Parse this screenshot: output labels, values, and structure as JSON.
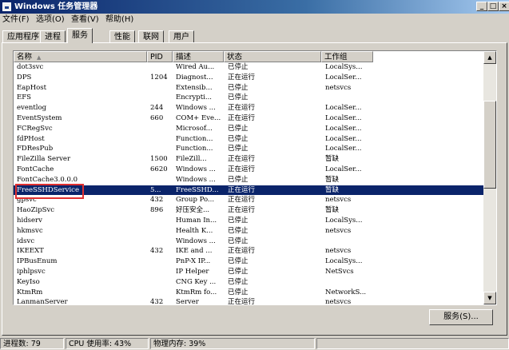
{
  "window": {
    "title": "Windows 任务管理器",
    "minimize": "_",
    "maximize": "□",
    "close": "×"
  },
  "menu": [
    "文件(F)",
    "选项(O)",
    "查看(V)",
    "帮助(H)"
  ],
  "tabs": [
    "应用程序",
    "进程",
    "服务",
    "性能",
    "联网",
    "用户"
  ],
  "active_tab": "服务",
  "columns": {
    "name": "名称",
    "pid": "PID",
    "desc": "描述",
    "status": "状态",
    "group": "工作组"
  },
  "rows": [
    {
      "name": "dot3svc",
      "pid": "",
      "desc": "Wired Au...",
      "status": "已停止",
      "group": "LocalSys..."
    },
    {
      "name": "DPS",
      "pid": "1204",
      "desc": "Diagnost...",
      "status": "正在运行",
      "group": "LocalSer..."
    },
    {
      "name": "EapHost",
      "pid": "",
      "desc": "Extensib...",
      "status": "已停止",
      "group": "netsvcs"
    },
    {
      "name": "EFS",
      "pid": "",
      "desc": "Encrypti...",
      "status": "已停止",
      "group": ""
    },
    {
      "name": "eventlog",
      "pid": "244",
      "desc": "Windows ...",
      "status": "正在运行",
      "group": "LocalSer..."
    },
    {
      "name": "EventSystem",
      "pid": "660",
      "desc": "COM+ Eve...",
      "status": "正在运行",
      "group": "LocalSer..."
    },
    {
      "name": "FCRegSvc",
      "pid": "",
      "desc": "Microsof...",
      "status": "已停止",
      "group": "LocalSer..."
    },
    {
      "name": "fdPHost",
      "pid": "",
      "desc": "Function...",
      "status": "已停止",
      "group": "LocalSer..."
    },
    {
      "name": "FDResPub",
      "pid": "",
      "desc": "Function...",
      "status": "已停止",
      "group": "LocalSer..."
    },
    {
      "name": "FileZilla Server",
      "pid": "1500",
      "desc": "FileZill...",
      "status": "正在运行",
      "group": "暂缺"
    },
    {
      "name": "FontCache",
      "pid": "6620",
      "desc": "Windows ...",
      "status": "正在运行",
      "group": "LocalSer..."
    },
    {
      "name": "FontCache3.0.0.0",
      "pid": "",
      "desc": "Windows ...",
      "status": "已停止",
      "group": "暂缺"
    },
    {
      "name": "FreeSSHDService",
      "pid": "5...",
      "desc": "FreeSSHD...",
      "status": "正在运行",
      "group": "暂缺",
      "selected": true
    },
    {
      "name": "gpsvc",
      "pid": "432",
      "desc": "Group Po...",
      "status": "正在运行",
      "group": "netsvcs"
    },
    {
      "name": "HaoZipSvc",
      "pid": "896",
      "desc": "好压安全...",
      "status": "正在运行",
      "group": "暂缺"
    },
    {
      "name": "hidserv",
      "pid": "",
      "desc": "Human In...",
      "status": "已停止",
      "group": "LocalSys..."
    },
    {
      "name": "hkmsvc",
      "pid": "",
      "desc": "Health K...",
      "status": "已停止",
      "group": "netsvcs"
    },
    {
      "name": "idsvc",
      "pid": "",
      "desc": "Windows ...",
      "status": "已停止",
      "group": ""
    },
    {
      "name": "IKEEXT",
      "pid": "432",
      "desc": "IKE and ...",
      "status": "正在运行",
      "group": "netsvcs"
    },
    {
      "name": "IPBusEnum",
      "pid": "",
      "desc": "PnP-X IP...",
      "status": "已停止",
      "group": "LocalSys..."
    },
    {
      "name": "iphlpsvc",
      "pid": "",
      "desc": "IP Helper",
      "status": "已停止",
      "group": "NetSvcs"
    },
    {
      "name": "KeyIso",
      "pid": "",
      "desc": "CNG Key ...",
      "status": "已停止",
      "group": ""
    },
    {
      "name": "KtmRm",
      "pid": "",
      "desc": "KtmRm fo...",
      "status": "已停止",
      "group": "NetworkS..."
    },
    {
      "name": "LanmanServer",
      "pid": "432",
      "desc": "Server",
      "status": "正在运行",
      "group": "netsvcs"
    }
  ],
  "services_button": "服务(S)...",
  "status": {
    "processes": "进程数: 79",
    "cpu": "CPU 使用率: 43%",
    "memory": "物理内存: 39%"
  },
  "icons": {
    "window": "task-manager-icon",
    "sort": "sort-up-icon",
    "scroll_up": "up-arrow-icon",
    "scroll_down": "down-arrow-icon"
  },
  "colors": {
    "title_bar": "#0a246a",
    "selection": "#0a246a",
    "highlight_box": "#e03030"
  }
}
